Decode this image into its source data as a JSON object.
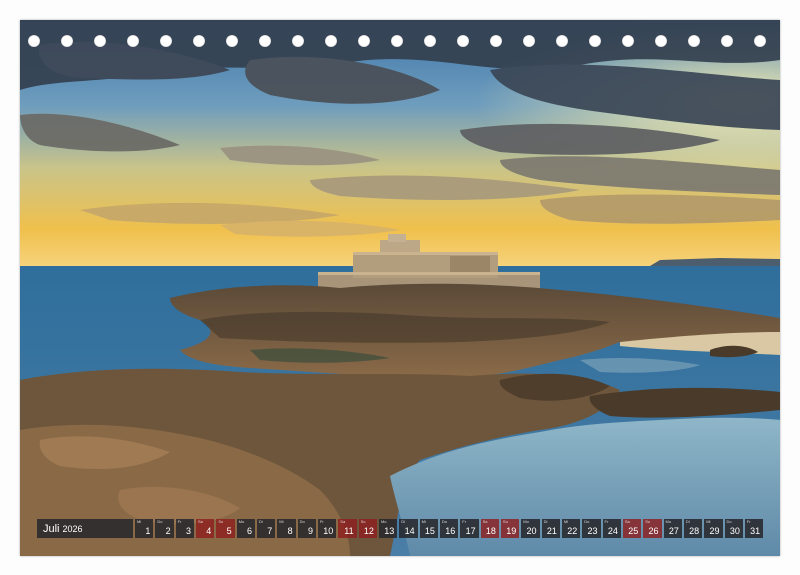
{
  "calendar": {
    "month": "Juli",
    "year": "2026",
    "days": [
      {
        "d": "1",
        "w": "Mi",
        "we": false
      },
      {
        "d": "2",
        "w": "Do",
        "we": false
      },
      {
        "d": "3",
        "w": "Fr",
        "we": false
      },
      {
        "d": "4",
        "w": "Sa",
        "we": true
      },
      {
        "d": "5",
        "w": "So",
        "we": true
      },
      {
        "d": "6",
        "w": "Mo",
        "we": false
      },
      {
        "d": "7",
        "w": "Di",
        "we": false
      },
      {
        "d": "8",
        "w": "Mi",
        "we": false
      },
      {
        "d": "9",
        "w": "Do",
        "we": false
      },
      {
        "d": "10",
        "w": "Fr",
        "we": false
      },
      {
        "d": "11",
        "w": "Sa",
        "we": true
      },
      {
        "d": "12",
        "w": "So",
        "we": true
      },
      {
        "d": "13",
        "w": "Mo",
        "we": false
      },
      {
        "d": "14",
        "w": "Di",
        "we": false
      },
      {
        "d": "15",
        "w": "Mi",
        "we": false
      },
      {
        "d": "16",
        "w": "Do",
        "we": false
      },
      {
        "d": "17",
        "w": "Fr",
        "we": false
      },
      {
        "d": "18",
        "w": "Sa",
        "we": true
      },
      {
        "d": "19",
        "w": "So",
        "we": true
      },
      {
        "d": "20",
        "w": "Mo",
        "we": false
      },
      {
        "d": "21",
        "w": "Di",
        "we": false
      },
      {
        "d": "22",
        "w": "Mi",
        "we": false
      },
      {
        "d": "23",
        "w": "Do",
        "we": false
      },
      {
        "d": "24",
        "w": "Fr",
        "we": false
      },
      {
        "d": "25",
        "w": "Sa",
        "we": true
      },
      {
        "d": "26",
        "w": "So",
        "we": true
      },
      {
        "d": "27",
        "w": "Mo",
        "we": false
      },
      {
        "d": "28",
        "w": "Di",
        "we": false
      },
      {
        "d": "29",
        "w": "Mi",
        "we": false
      },
      {
        "d": "30",
        "w": "Do",
        "we": false
      },
      {
        "d": "31",
        "w": "Fr",
        "we": false
      }
    ]
  },
  "binding": {
    "hole_count": 23
  },
  "colors": {
    "weekday_cell": "#28282c",
    "weekend_cell": "#8c1e1e",
    "sky_top": "#4a7fb0",
    "sky_horizon": "#f2c24e",
    "sea": "#3c6d96"
  }
}
